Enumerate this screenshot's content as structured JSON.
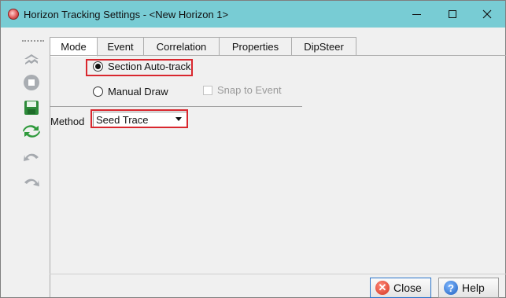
{
  "window": {
    "title": "Horizon Tracking Settings - <New Horizon 1>",
    "controls": {
      "minimize": "–",
      "maximize": "☐",
      "close": "✕"
    }
  },
  "toolbar": {
    "tools": [
      "horizon-icon",
      "stop-icon",
      "save-icon",
      "retrack-icon",
      "undo-icon",
      "redo-icon"
    ]
  },
  "tabs": [
    {
      "label": "Mode",
      "active": true
    },
    {
      "label": "Event",
      "active": false
    },
    {
      "label": "Correlation",
      "active": false
    },
    {
      "label": "Properties",
      "active": false
    },
    {
      "label": "DipSteer",
      "active": false
    }
  ],
  "mode": {
    "section_autotrack": {
      "label": "Section Auto-track",
      "selected": true
    },
    "manual_draw": {
      "label": "Manual Draw",
      "selected": false
    },
    "snap_to_event": {
      "label": "Snap to Event",
      "checked": false,
      "enabled": false
    }
  },
  "method": {
    "label": "Method",
    "value": "Seed Trace"
  },
  "buttons": {
    "close": "Close",
    "help": "Help"
  },
  "colors": {
    "titlebar": "#78ccd4",
    "highlight": "#d9272e",
    "accent": "#2a73c9"
  }
}
